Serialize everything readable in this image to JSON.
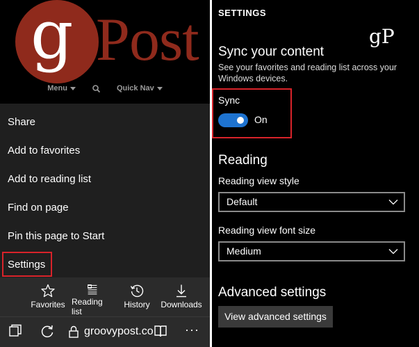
{
  "left": {
    "logo": {
      "letter": "g",
      "word": "Post",
      "brand_color": "#8f2a1c"
    },
    "site_nav": {
      "menu_label": "Menu",
      "quick_nav_label": "Quick Nav"
    },
    "menu_items": [
      {
        "label": "Share"
      },
      {
        "label": "Add to favorites"
      },
      {
        "label": "Add to reading list"
      },
      {
        "label": "Find on page"
      },
      {
        "label": "Pin this page to Start"
      },
      {
        "label": "Settings"
      }
    ],
    "toolbar": {
      "favorites": "Favorites",
      "reading_list": "Reading list",
      "history": "History",
      "downloads": "Downloads"
    },
    "address_bar": {
      "url": "groovypost.co",
      "more": "···"
    }
  },
  "right": {
    "header": "SETTINGS",
    "logo": "gP",
    "sync": {
      "heading": "Sync your content",
      "description": "See your favorites and reading list across your Windows devices.",
      "label": "Sync",
      "state": "On",
      "toggle_color": "#1e73d0"
    },
    "reading": {
      "heading": "Reading",
      "style_label": "Reading view style",
      "style_value": "Default",
      "font_label": "Reading view font size",
      "font_value": "Medium"
    },
    "advanced": {
      "heading": "Advanced settings",
      "button_label": "View advanced settings"
    },
    "highlight_color": "#d8232a"
  }
}
